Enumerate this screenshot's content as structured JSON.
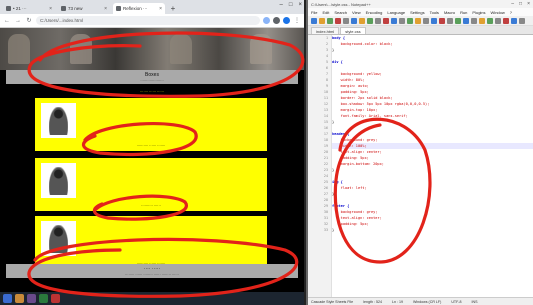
{
  "browser": {
    "tabs": [
      {
        "label": "• 21 ···"
      },
      {
        "label": "73 new"
      },
      {
        "label": "Reflexion ···"
      }
    ],
    "url": "C:/Users/...index.html",
    "page": {
      "header_title": "Boxes",
      "header_sub": "····················",
      "link_text": "······· ······ ······",
      "cards": [
        {
          "caption": "·········· ······ ·······"
        },
        {
          "caption": "·········· ······"
        },
        {
          "caption": "·········· ······ ·······"
        }
      ],
      "footer_title": "···· ·····",
      "footer_sub": "········ ······ ········ ······ ········ ······"
    }
  },
  "editor": {
    "title": "C:\\Users\\...\\style.css - Notepad++",
    "menu": [
      "File",
      "Edit",
      "Search",
      "View",
      "Encoding",
      "Language",
      "Settings",
      "Tools",
      "Macro",
      "Run",
      "Plugins",
      "Window",
      "?"
    ],
    "tabs": [
      {
        "label": "index.html"
      },
      {
        "label": "style.css"
      }
    ],
    "line_numbers": [
      "1",
      "2",
      "3",
      "4",
      "5",
      "6",
      "7",
      "8",
      "9",
      "10",
      "11",
      "12",
      "13",
      "14",
      "15",
      "16",
      "17",
      "18",
      "19",
      "20",
      "21",
      "22",
      "23",
      "24",
      "25",
      "26",
      "27",
      "28",
      "29",
      "30",
      "31",
      "32",
      "33"
    ],
    "code": [
      {
        "text": "body {"
      },
      {
        "text": "    background-color: black;"
      },
      {
        "text": "}"
      },
      {
        "text": ""
      },
      {
        "text": "div {"
      },
      {
        "text": ""
      },
      {
        "text": "    background: yellow;"
      },
      {
        "text": "    width: 80%;"
      },
      {
        "text": "    margin: auto;"
      },
      {
        "text": "    padding: 5px;"
      },
      {
        "text": "    border: 2px solid black;"
      },
      {
        "text": "    box-shadow: 5px 5px 10px rgba(0,0,0,0.5);"
      },
      {
        "text": "    margin-top: 10px;"
      },
      {
        "text": "    font-family: Arial, sans-serif;"
      },
      {
        "text": "}"
      },
      {
        "text": ""
      },
      {
        "text": "header {"
      },
      {
        "text": "    background: grey;"
      },
      {
        "text": "    width: 100%;"
      },
      {
        "text": "    text-align: center;"
      },
      {
        "text": "    padding: 5px;"
      },
      {
        "text": "    margin-bottom: 20px;"
      },
      {
        "text": "}"
      },
      {
        "text": ""
      },
      {
        "text": "img {"
      },
      {
        "text": "    float: left;"
      },
      {
        "text": "}"
      },
      {
        "text": ""
      },
      {
        "text": "footer {"
      },
      {
        "text": "    background: grey;"
      },
      {
        "text": "    text-align: center;"
      },
      {
        "text": "    padding: 5px;"
      },
      {
        "text": "}"
      }
    ],
    "status": [
      "Cascade Style Sheets File",
      "length : 524",
      "Ln : 19",
      "Windows (CR LF)",
      "UTF-8",
      "INS"
    ]
  },
  "colors": {
    "page_bg": "#000000",
    "card_bg": "#ffff00",
    "header_bg": "#a9a9a9",
    "annotation": "#e2231a"
  }
}
